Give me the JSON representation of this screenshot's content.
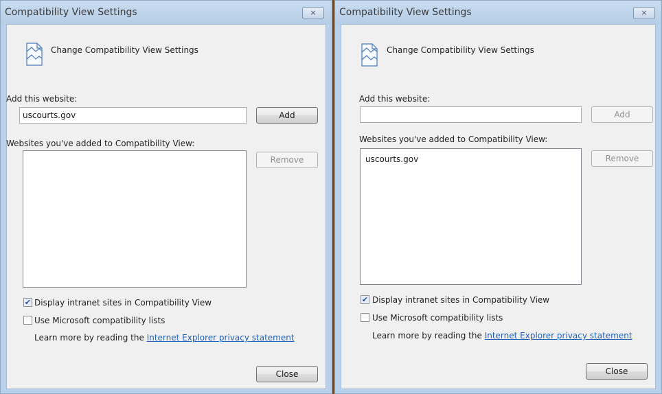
{
  "dialogs": [
    {
      "title": "Compatibility View Settings",
      "close_glyph": "⨯",
      "header": "Change Compatibility View Settings",
      "add_label": "Add this website:",
      "add_value": "uscourts.gov",
      "add_button": "Add",
      "add_enabled": true,
      "list_label": "Websites you've added to Compatibility View:",
      "list_items": [],
      "remove_button": "Remove",
      "checkbox_intranet": {
        "label": "Display intranet sites in Compatibility View",
        "checked": true
      },
      "checkbox_mslists": {
        "label": "Use Microsoft compatibility lists",
        "checked": false
      },
      "learn_more_prefix": "Learn more by reading the ",
      "learn_more_link": "Internet Explorer privacy statement",
      "close_button": "Close"
    },
    {
      "title": "Compatibility View Settings",
      "close_glyph": "⨯",
      "header": "Change Compatibility View Settings",
      "add_label": "Add this website:",
      "add_value": "",
      "add_button": "Add",
      "add_enabled": false,
      "list_label": "Websites you've added to Compatibility View:",
      "list_items": [
        "uscourts.gov"
      ],
      "remove_button": "Remove",
      "checkbox_intranet": {
        "label": "Display intranet sites in Compatibility View",
        "checked": true
      },
      "checkbox_mslists": {
        "label": "Use Microsoft compatibility lists",
        "checked": false
      },
      "learn_more_prefix": "Learn more by reading the ",
      "learn_more_link": "Internet Explorer privacy statement",
      "close_button": "Close"
    }
  ],
  "icons": {
    "header": "compatibility-view-icon",
    "check": "✔"
  }
}
